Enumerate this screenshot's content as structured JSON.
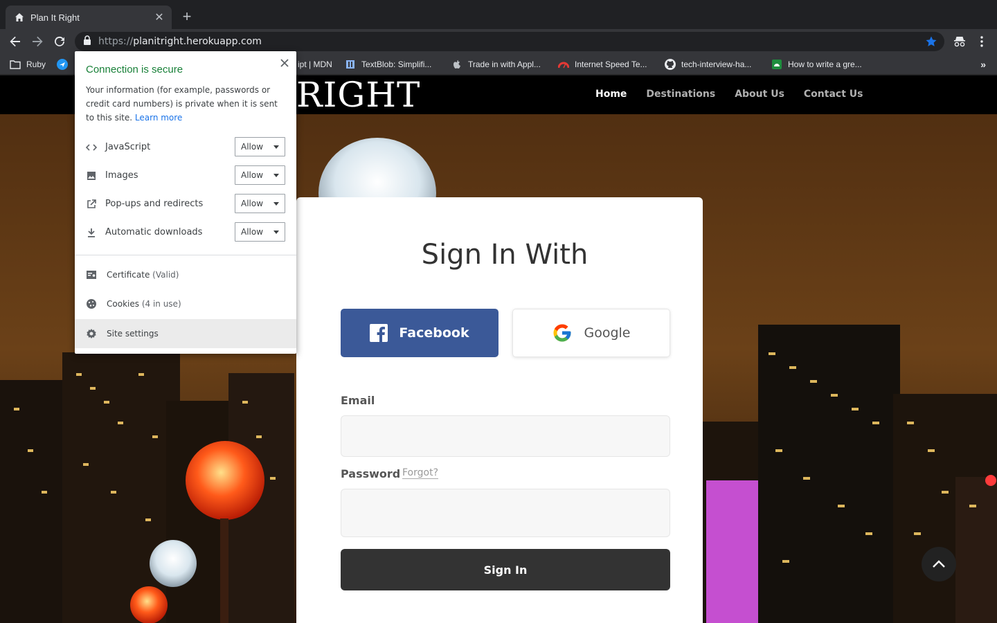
{
  "browser": {
    "tab_title": "Plan It Right",
    "new_tab_icon": "plus-icon",
    "url_scheme": "https://",
    "url_host": "planitright.herokuapp.com",
    "bookmarks": [
      {
        "label": "Ruby",
        "icon": "folder-icon"
      },
      {
        "label": "",
        "icon": "plane-icon"
      },
      {
        "label": "ipt | MDN",
        "icon": ""
      },
      {
        "label": "TextBlob: Simplifi...",
        "icon": "book-icon"
      },
      {
        "label": "Trade in with Appl...",
        "icon": "apple-icon"
      },
      {
        "label": "Internet Speed Te...",
        "icon": "speedometer-icon"
      },
      {
        "label": "tech-interview-ha...",
        "icon": "github-icon"
      },
      {
        "label": "How to write a gre...",
        "icon": "android-icon"
      }
    ],
    "bookmarks_more": "»"
  },
  "site": {
    "logo_text": "RIGHT",
    "nav": [
      {
        "label": "Home",
        "active": true
      },
      {
        "label": "Destinations",
        "active": false
      },
      {
        "label": "About Us",
        "active": false
      },
      {
        "label": "Contact Us",
        "active": false
      }
    ]
  },
  "signin": {
    "heading": "Sign In With",
    "facebook_label": "Facebook",
    "google_label": "Google",
    "email_label": "Email",
    "email_value": "",
    "password_label": "Password",
    "forgot_label": "Forgot?",
    "password_value": "",
    "submit_label": "Sign In"
  },
  "popup": {
    "title": "Connection is secure",
    "description": "Your information (for example, passwords or credit card numbers) is private when it is sent to this site.",
    "learn_more": "Learn more",
    "permissions": [
      {
        "name": "JavaScript",
        "value": "Allow",
        "icon": "code-icon"
      },
      {
        "name": "Images",
        "value": "Allow",
        "icon": "image-icon"
      },
      {
        "name": "Pop-ups and redirects",
        "value": "Allow",
        "icon": "external-link-icon"
      },
      {
        "name": "Automatic downloads",
        "value": "Allow",
        "icon": "download-icon"
      }
    ],
    "certificate_label": "Certificate",
    "certificate_status": "(Valid)",
    "cookies_label": "Cookies",
    "cookies_status": "(4 in use)",
    "site_settings_label": "Site settings"
  },
  "colors": {
    "secure_green": "#188038",
    "facebook_blue": "#3b5998",
    "link_blue": "#1a73e8",
    "bookmark_star": "#8ab4f8"
  }
}
